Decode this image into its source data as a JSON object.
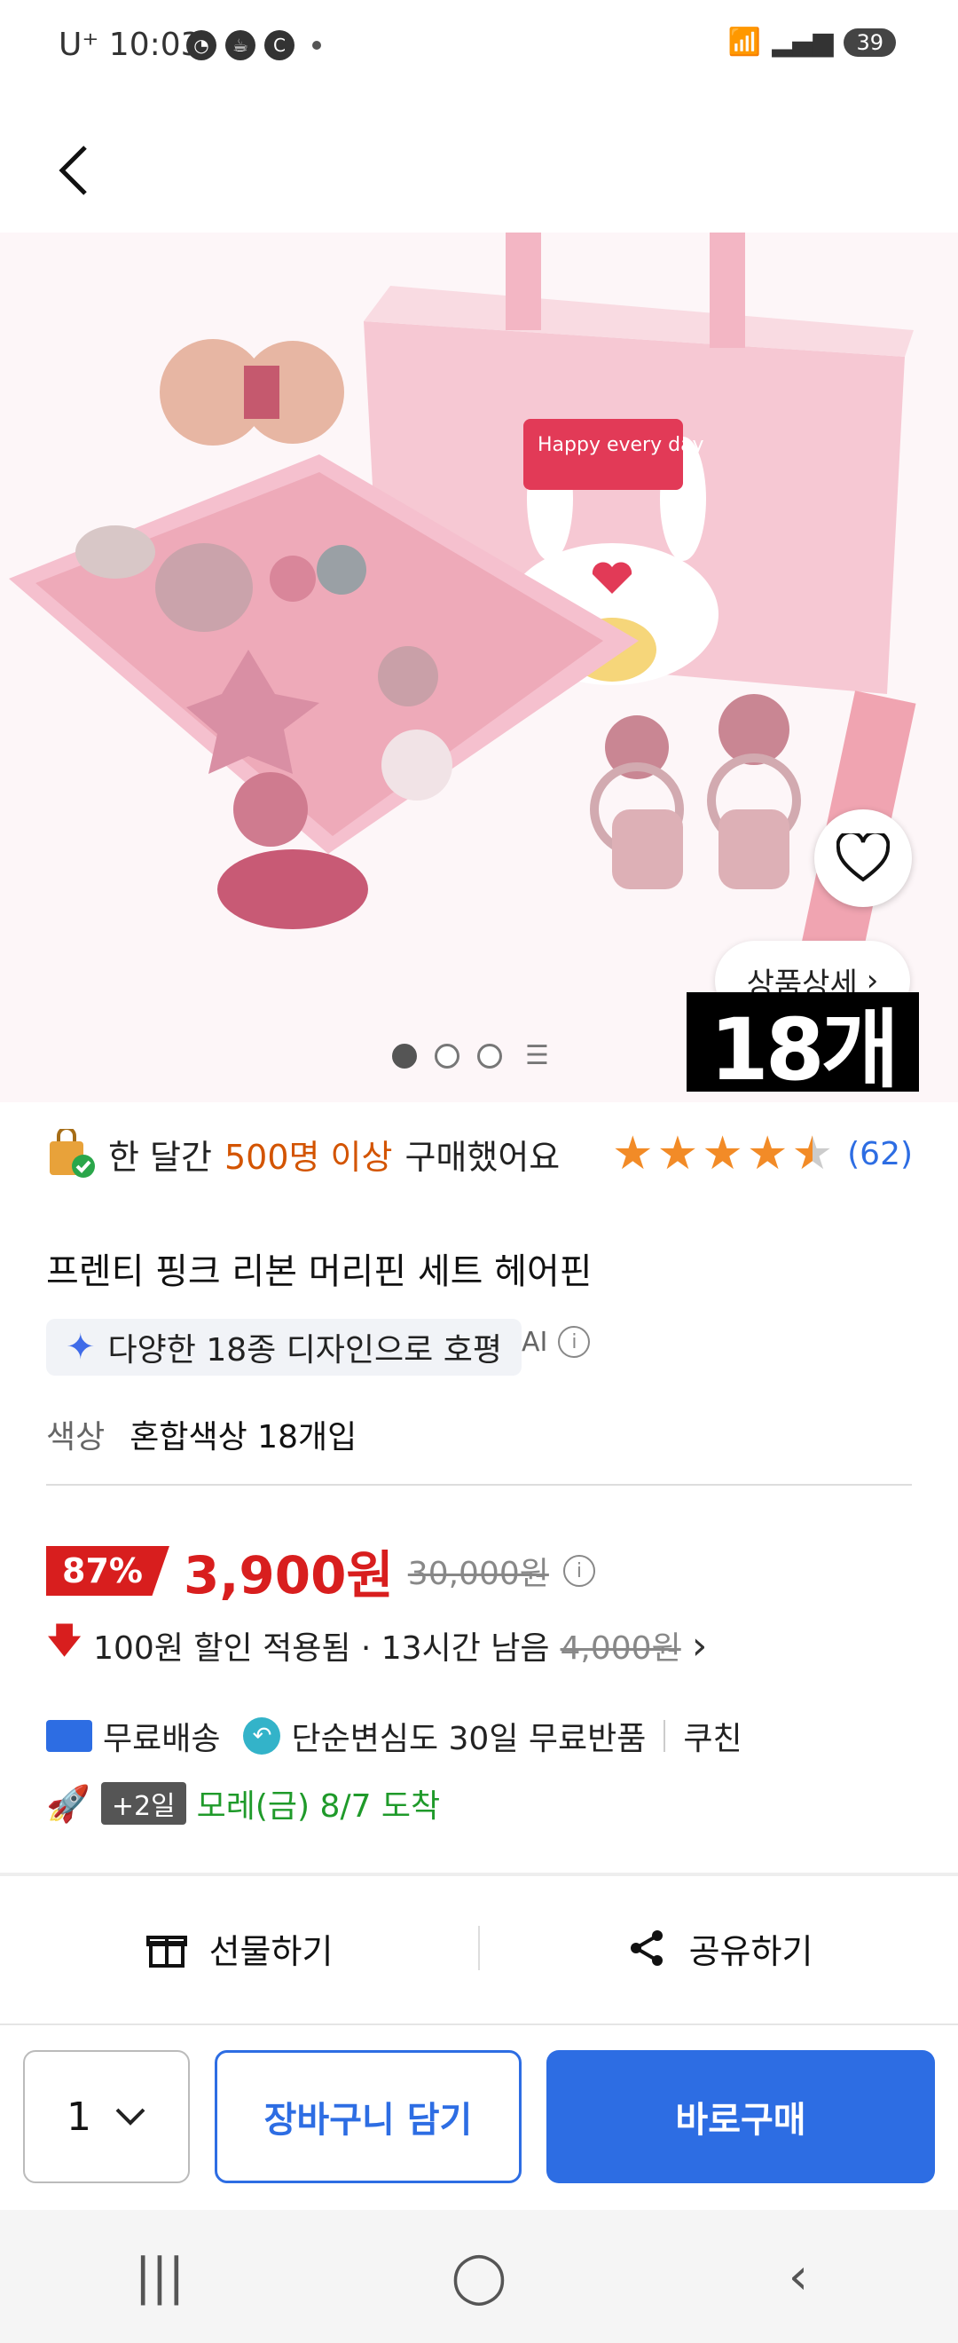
{
  "status": {
    "time": "U⁺ 10:03",
    "battery": "39"
  },
  "hero": {
    "box_text": "Happy every day",
    "count_badge": "18개",
    "detail_label": "상품상세"
  },
  "summary": {
    "purchase_pre": "한 달간",
    "purchase_hl": "500명 이상",
    "purchase_post": "구매했어요",
    "rating": 4.5,
    "review_count": "(62)"
  },
  "product": {
    "title": "프렌티 핑크 리본 머리핀 세트 헤어핀",
    "ai_summary": "다양한 18종 디자인으로 호평",
    "ai_label": "AI",
    "option_key": "색상",
    "option_value": "혼합색상 18개입"
  },
  "price": {
    "discount": "87%",
    "sale": "3,900원",
    "original": "30,000원",
    "coupon_text": "100원 할인 적용됨 · 13시간 남음",
    "coupon_before": "4,000원"
  },
  "shipping": {
    "free": "무료배송",
    "return": "단순변심도 30일 무료반품",
    "seller": "쿠친",
    "days_badge": "+2일",
    "arrival": "모레(금) 8/7 도착"
  },
  "actions": {
    "gift": "선물하기",
    "share": "공유하기"
  },
  "bottom": {
    "qty": "1",
    "cart": "장바구니 담기",
    "buy": "바로구매"
  },
  "colors": {
    "accent": "#2d6de3",
    "sale": "#d81e1e",
    "arrival": "#1f9a2a",
    "star": "#f28b27"
  }
}
